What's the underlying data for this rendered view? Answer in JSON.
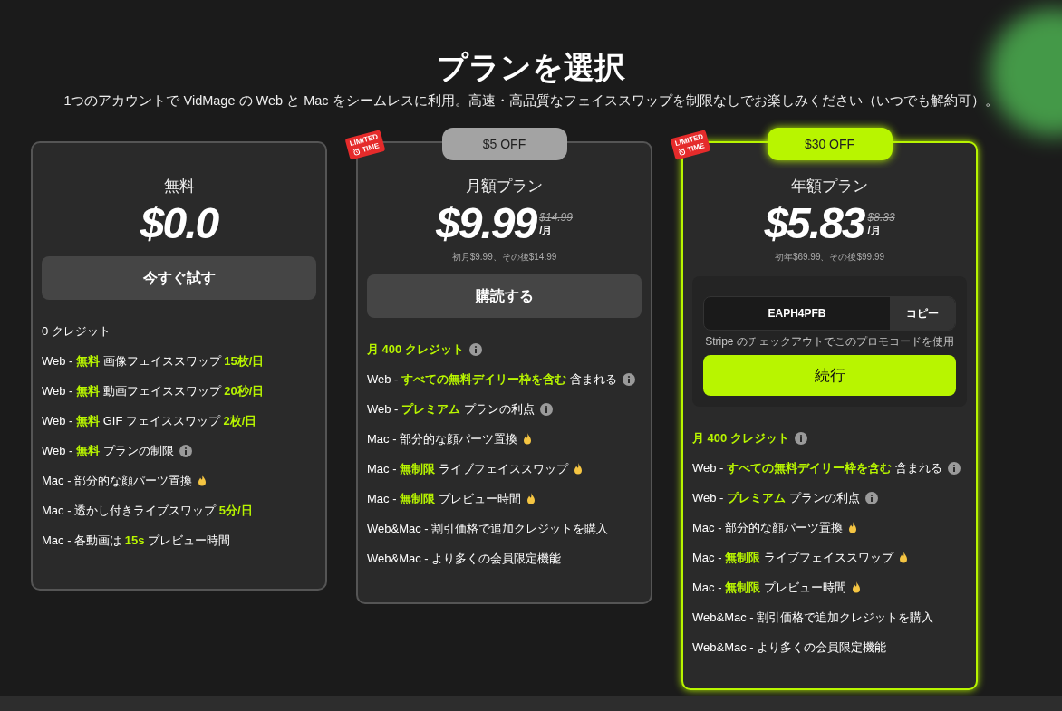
{
  "title": "プランを選択",
  "subtitle": "1つのアカウントで VidMage の Web と Mac をシームレスに利用。高速・高品質なフェイススワップを制限なしでお楽しみください（いつでも解約可）。",
  "plans": [
    {
      "name": "無料",
      "price": "$0.0",
      "featured": false,
      "button": "今すぐ試す",
      "features": [
        {
          "text": "0 クレジット",
          "highlight": false,
          "kind": "plain"
        },
        {
          "text": "Web - **無料** 画像フェイススワップ **15枚/日**",
          "highlight": false,
          "kind": "plain"
        },
        {
          "text": "Web - **無料** 動画フェイススワップ **20秒/日**",
          "highlight": false,
          "kind": "plain"
        },
        {
          "text": "Web - **無料** GIF フェイススワップ **2枚/日**",
          "highlight": false,
          "kind": "plain"
        },
        {
          "text": "Web - **無料** プランの制限",
          "highlight": false,
          "kind": "info"
        },
        {
          "text": "Mac - 部分的な顔パーツ置換",
          "highlight": false,
          "kind": "hot"
        },
        {
          "text": "Mac - 透かし付きライブスワップ **5分/日**",
          "highlight": false,
          "kind": "plain"
        },
        {
          "text": "Mac - 各動画は **15s** プレビュー時間",
          "highlight": false,
          "kind": "plain"
        }
      ]
    },
    {
      "name": "月額プラン",
      "price": "$9.99",
      "old_price": "$14.99",
      "per": "/月",
      "note": "初月$9.99、その後$14.99",
      "featured": false,
      "badge": "$5 OFF",
      "limited": [
        "LIMITED",
        "TIME"
      ],
      "button": "購読する",
      "features": [
        {
          "text": "月 400 クレジット",
          "highlight": true,
          "kind": "info"
        },
        {
          "text": "Web - **すべての無料デイリー枠を含む** 含まれる",
          "highlight": false,
          "kind": "info"
        },
        {
          "text": "Web - **プレミアム** プランの利点",
          "highlight": false,
          "kind": "info"
        },
        {
          "text": "Mac - 部分的な顔パーツ置換",
          "highlight": false,
          "kind": "hot"
        },
        {
          "text": "Mac - **無制限** ライブフェイススワップ",
          "highlight": false,
          "kind": "hot"
        },
        {
          "text": "Mac - **無制限** プレビュー時間",
          "highlight": false,
          "kind": "hot"
        },
        {
          "text": "Web&Mac - 割引価格で追加クレジットを購入",
          "highlight": false,
          "kind": "plain"
        },
        {
          "text": "Web&Mac - より多くの会員限定機能",
          "highlight": false,
          "kind": "plain"
        }
      ]
    },
    {
      "name": "年額プラン",
      "price": "$5.83",
      "old_price": "$8.33",
      "per": "/月",
      "note": "初年$69.99、その後$99.99",
      "featured": true,
      "badge": "$30 OFF",
      "limited": [
        "LIMITED",
        "TIME"
      ],
      "promo": {
        "code": "EAPH4PFB",
        "copy": "コピー",
        "hint": "Stripe のチェックアウトでこのプロモコードを使用"
      },
      "button": "続行",
      "features": [
        {
          "text": "月 400 クレジット",
          "highlight": true,
          "kind": "info"
        },
        {
          "text": "Web - **すべての無料デイリー枠を含む** 含まれる",
          "highlight": false,
          "kind": "info"
        },
        {
          "text": "Web - **プレミアム** プランの利点",
          "highlight": false,
          "kind": "info"
        },
        {
          "text": "Mac - 部分的な顔パーツ置換",
          "highlight": false,
          "kind": "hot"
        },
        {
          "text": "Mac - **無制限** ライブフェイススワップ",
          "highlight": false,
          "kind": "hot"
        },
        {
          "text": "Mac - **無制限** プレビュー時間",
          "highlight": false,
          "kind": "hot"
        },
        {
          "text": "Web&Mac - 割引価格で追加クレジットを購入",
          "highlight": false,
          "kind": "plain"
        },
        {
          "text": "Web&Mac - より多くの会員限定機能",
          "highlight": false,
          "kind": "plain"
        }
      ]
    }
  ]
}
